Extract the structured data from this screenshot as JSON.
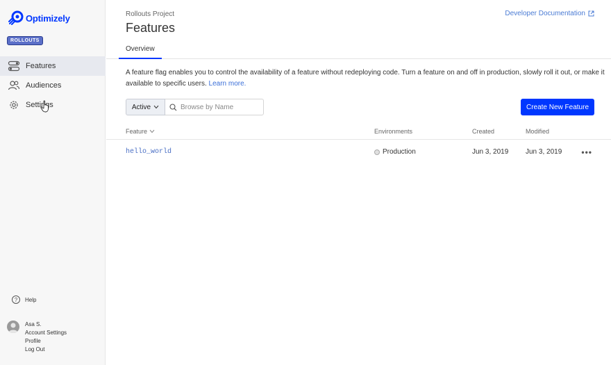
{
  "brand": {
    "name": "Optimizely",
    "badge": "ROLLOUTS",
    "color": "#0037ff"
  },
  "sidebar": {
    "items": [
      {
        "label": "Features",
        "icon": "toggle-icon",
        "active": true
      },
      {
        "label": "Audiences",
        "icon": "audience-icon",
        "active": false
      },
      {
        "label": "Settings",
        "icon": "gear-icon",
        "active": false
      }
    ],
    "help_label": "Help",
    "user": {
      "name": "Asa S.",
      "account_settings": "Account Settings",
      "profile": "Profile",
      "logout": "Log Out"
    }
  },
  "header": {
    "project": "Rollouts Project",
    "title": "Features",
    "dev_docs": "Developer Documentation"
  },
  "tabs": [
    {
      "label": "Overview",
      "active": true
    }
  ],
  "description": {
    "text": "A feature flag enables you to control the availability of a feature without redeploying code. Turn a feature on and off in production, slowly roll it out, or make it available to specific users.",
    "link": "Learn more."
  },
  "filter": {
    "status": "Active",
    "search_placeholder": "Browse by Name"
  },
  "create_button": "Create New Feature",
  "table": {
    "columns": {
      "feature": "Feature",
      "environments": "Environments",
      "created": "Created",
      "modified": "Modified"
    },
    "rows": [
      {
        "key": "hello_world",
        "environment": "Production",
        "created": "Jun 3, 2019",
        "modified": "Jun 3, 2019"
      }
    ],
    "more_label": "•••"
  }
}
